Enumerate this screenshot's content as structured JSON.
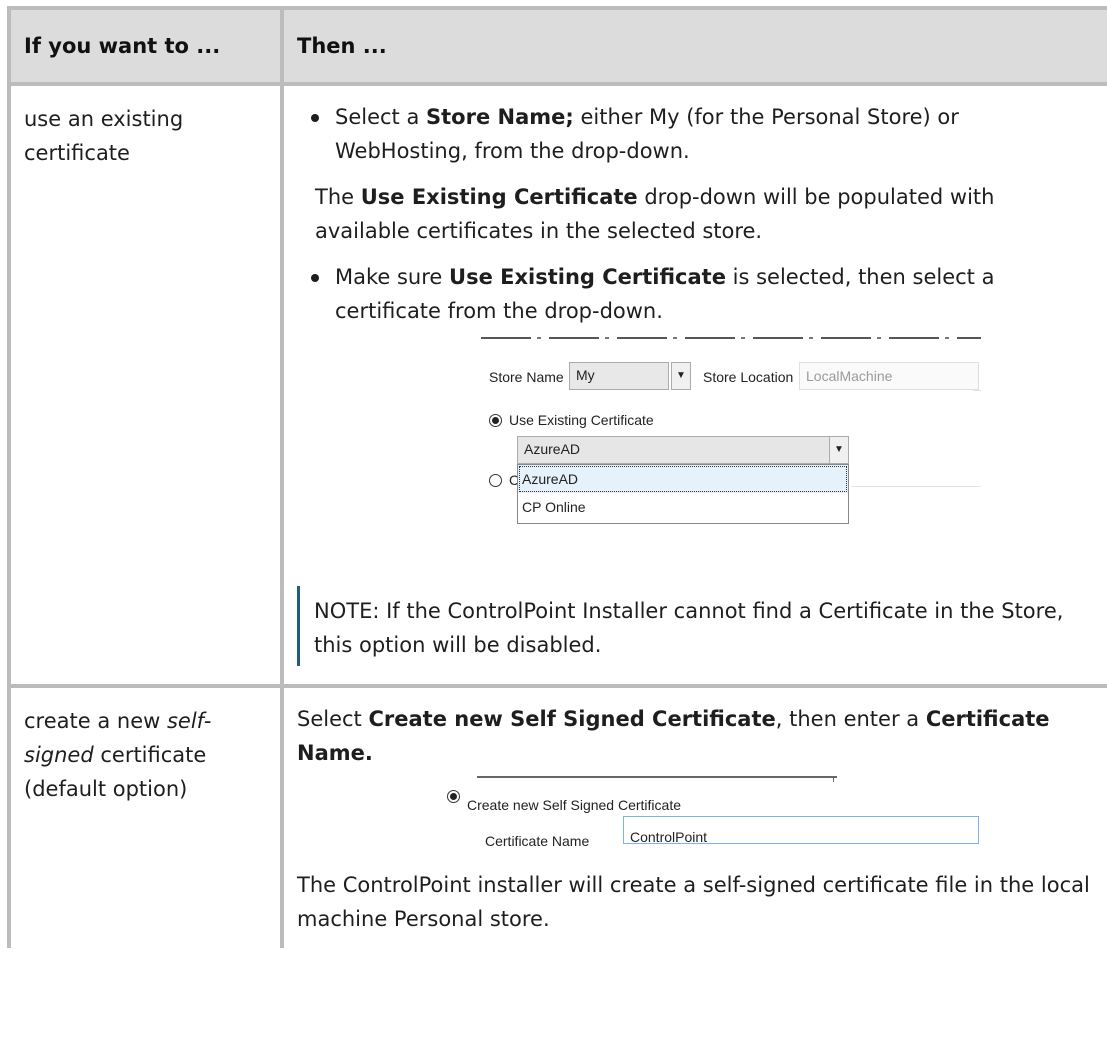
{
  "header": {
    "col1": "If you want to ...",
    "col2": "Then ..."
  },
  "row1": {
    "left": "use an existing certificate",
    "bullet1_pre": "Select a ",
    "bullet1_bold": "Store Name;",
    "bullet1_post": " either My (for the Personal Store) or WebHosting, from the drop-down.",
    "para_pre": "The ",
    "para_bold": "Use Existing Certificate",
    "para_post": " drop-down will be populated with available certificates in the selected store.",
    "bullet2_pre": "Make sure ",
    "bullet2_bold": "Use Existing Certificate",
    "bullet2_post": " is selected, then select a certificate from the drop-down.",
    "screenshot": {
      "store_name_label": "Store Name",
      "store_name_value": "My",
      "store_location_label": "Store Location",
      "store_location_value": "LocalMachine",
      "use_existing_label": "Use Existing Certificate",
      "cert_selected": "AzureAD",
      "dropdown_options": [
        "AzureAD",
        "CP Online"
      ],
      "create_partial_label": "Cr",
      "dropdown_arrow": "▼"
    },
    "note": "NOTE:  If the ControlPoint Installer cannot find a Certificate in the Store, this option will be disabled."
  },
  "row2": {
    "left_1": "create a new ",
    "left_italic": "self-signed",
    "left_2": " certificate (default option)",
    "para1_pre": "Select ",
    "para1_bold1": "Create new Self Signed Certificate",
    "para1_mid": ", then enter a ",
    "para1_bold2": "Certificate Name.",
    "screenshot": {
      "create_label": "Create new Self Signed Certificate",
      "cert_name_label": "Certificate Name",
      "cert_name_value": "ControlPoint"
    },
    "para2": "The ControlPoint installer will create a self-signed certificate file in the local machine Personal store."
  }
}
